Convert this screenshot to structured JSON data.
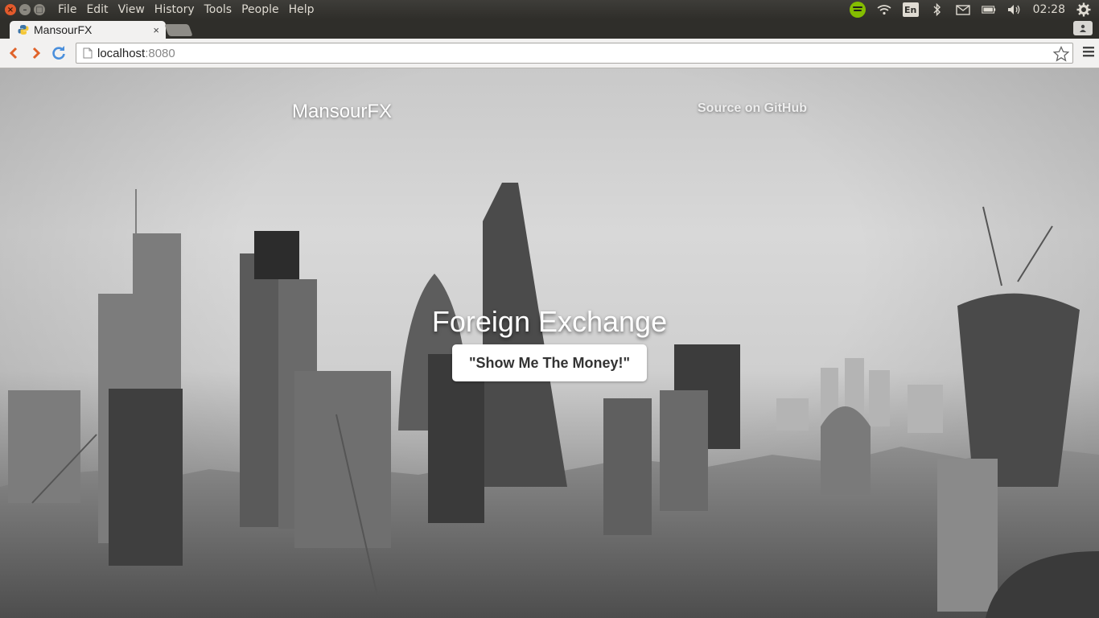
{
  "os": {
    "menu": [
      "File",
      "Edit",
      "View",
      "History",
      "Tools",
      "People",
      "Help"
    ],
    "language": "En",
    "clock": "02:28"
  },
  "browser": {
    "tab_title": "MansourFX",
    "tab_close": "×",
    "url_host": "localhost",
    "url_port": ":8080"
  },
  "page": {
    "brand": "MansourFX",
    "source_link": "Source on GitHub",
    "hero_title": "Foreign Exchange",
    "hero_button": "\"Show Me The Money!\""
  },
  "colors": {
    "spotify": "#84bd00",
    "close_button": "#e25a2c",
    "nav_arrows": "#e0632a",
    "reload": "#4a8fdc"
  }
}
